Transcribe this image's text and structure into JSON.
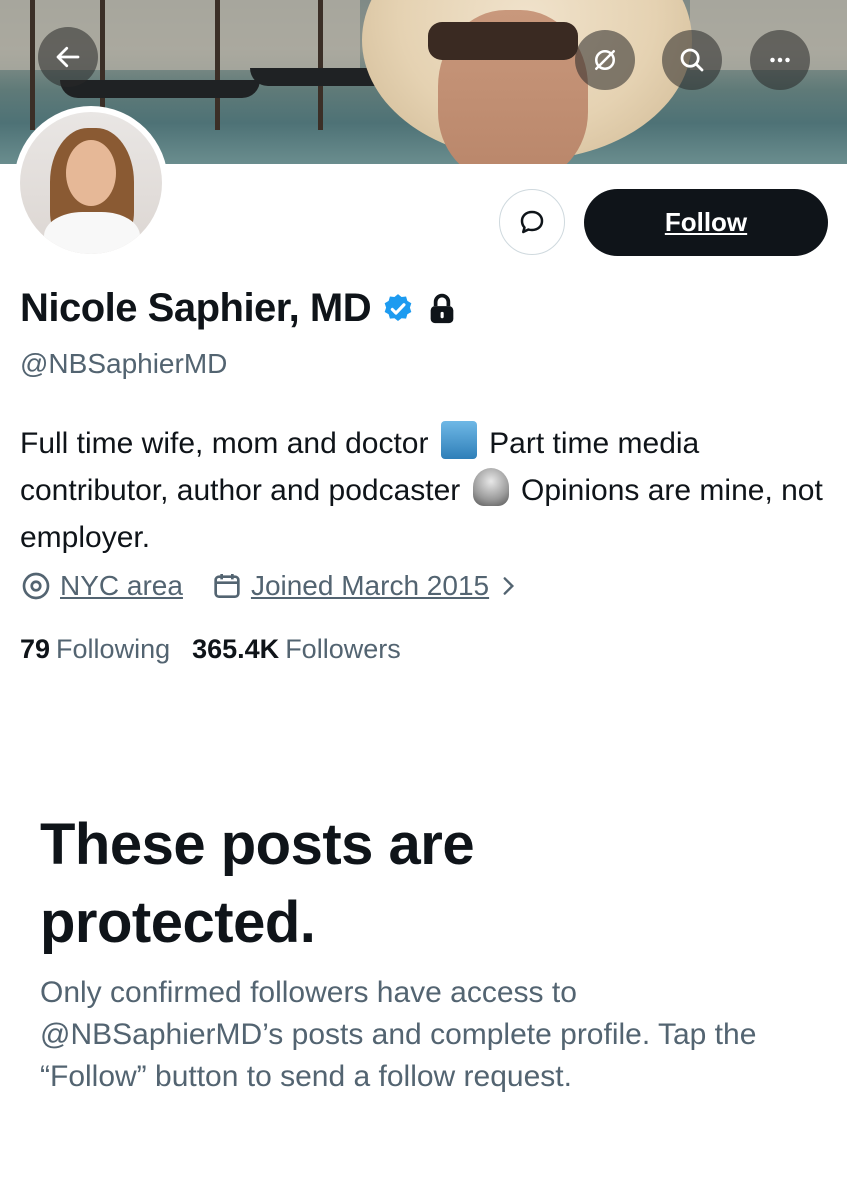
{
  "profile": {
    "name": "Nicole Saphier, MD",
    "handle": "@NBSaphierMD",
    "bio_part1": "Full time wife, mom and doctor",
    "bio_part2": "Part time media contributor, author and podcaster",
    "bio_part3": "Opinions are mine, not employer.",
    "location": "NYC area",
    "joined": "Joined March 2015",
    "following_count": "79",
    "following_label": "Following",
    "followers_count": "365.4K",
    "followers_label": "Followers"
  },
  "actions": {
    "follow_label": "Follow"
  },
  "protected": {
    "title": "These posts are protected.",
    "text": "Only confirmed followers have access to @NBSaphierMD’s posts and complete profile. Tap the “Follow” button to send a follow request."
  },
  "icons": {
    "back": "arrow-left-icon",
    "grok": "grok-icon",
    "search": "search-icon",
    "more": "more-icon",
    "message": "message-icon",
    "verified": "verified-badge-icon",
    "lock": "lock-icon",
    "location": "location-pin-icon",
    "calendar": "calendar-icon",
    "chevron": "chevron-right-icon"
  },
  "colors": {
    "primary_text": "#0f1419",
    "secondary_text": "#536471",
    "verified_blue": "#1d9bf0",
    "follow_button_bg": "#0f1419"
  }
}
